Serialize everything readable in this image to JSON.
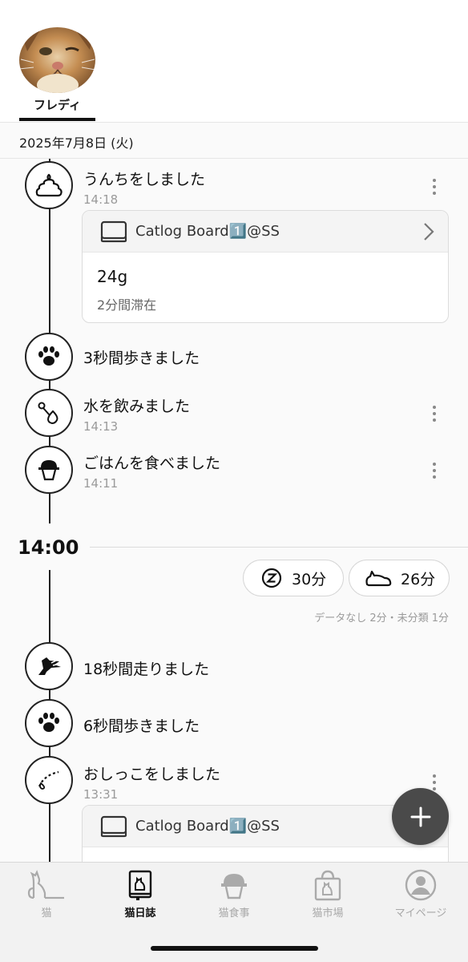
{
  "header": {
    "cat_name": "フレディ"
  },
  "date": "2025年7月8日 (火)",
  "events_upper": [
    {
      "title": "うんちをしました",
      "time": "14:18",
      "icon": "poop-icon",
      "card": {
        "device": "Catlog Board1️⃣@SS",
        "weight": "24g",
        "stay": "2分間滞在"
      }
    },
    {
      "title": "3秒間歩きました",
      "time": "",
      "icon": "paw-icon"
    },
    {
      "title": "水を飲みました",
      "time": "14:13",
      "icon": "water-drop-icon"
    },
    {
      "title": "ごはんを食べました",
      "time": "14:11",
      "icon": "food-bowl-icon"
    }
  ],
  "hour_marker": "14:00",
  "summary": {
    "sleep": {
      "icon": "sleep-z-icon",
      "value": "30分"
    },
    "rest": {
      "icon": "lying-cat-icon",
      "value": "26分"
    },
    "note": "データなし 2分・未分類 1分"
  },
  "events_lower": [
    {
      "title": "18秒間走りました",
      "time": "",
      "icon": "running-cat-icon"
    },
    {
      "title": "6秒間歩きました",
      "time": "",
      "icon": "paw-icon"
    },
    {
      "title": "おしっこをしました",
      "time": "13:31",
      "icon": "pee-icon",
      "card": {
        "device": "Catlog Board1️⃣@SS"
      }
    }
  ],
  "nav": [
    {
      "label": "猫",
      "icon": "cat-icon",
      "active": false
    },
    {
      "label": "猫日誌",
      "icon": "diary-icon",
      "active": true
    },
    {
      "label": "猫食事",
      "icon": "cat-food-icon",
      "active": false
    },
    {
      "label": "猫市場",
      "icon": "shopping-bag-icon",
      "active": false
    },
    {
      "label": "マイページ",
      "icon": "person-icon",
      "active": false
    }
  ],
  "colors": {
    "line": "#222222",
    "muted": "#9a9a9a",
    "fab": "#4a4a4a"
  }
}
